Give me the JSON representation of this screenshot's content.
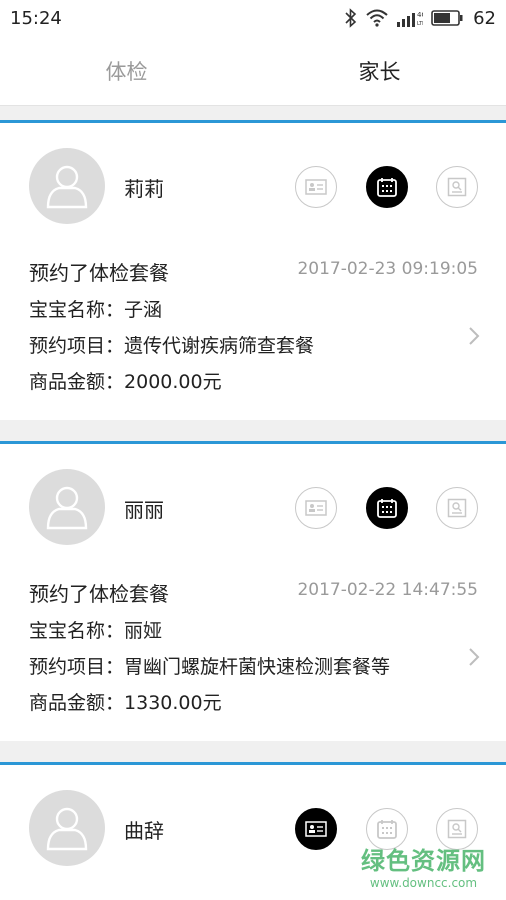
{
  "status": {
    "time": "15:24",
    "battery": "62",
    "net": "4G"
  },
  "tabs": [
    {
      "label": "体检",
      "active": false
    },
    {
      "label": "家长",
      "active": true
    }
  ],
  "cards": [
    {
      "name": "莉莉",
      "active_icon": 2,
      "title": "预约了体检套餐",
      "time": "2017-02-23 09:19:05",
      "baby_label": "宝宝名称：",
      "baby": "子涵",
      "item_label": "预约项目：",
      "item": "遗传代谢疾病筛查套餐",
      "amount_label": "商品金额：",
      "amount": "2000.00元"
    },
    {
      "name": "丽丽",
      "active_icon": 2,
      "title": "预约了体检套餐",
      "time": "2017-02-22 14:47:55",
      "baby_label": "宝宝名称：",
      "baby": "丽娅",
      "item_label": "预约项目：",
      "item": "胃幽门螺旋杆菌快速检测套餐等",
      "amount_label": "商品金额：",
      "amount": "1330.00元"
    },
    {
      "name": "曲辞",
      "active_icon": 1
    }
  ],
  "watermark": {
    "title": "绿色资源网",
    "url": "www.downcc.com"
  },
  "colors": {
    "accent": "#2b97d6",
    "watermark": "#49b56b"
  }
}
